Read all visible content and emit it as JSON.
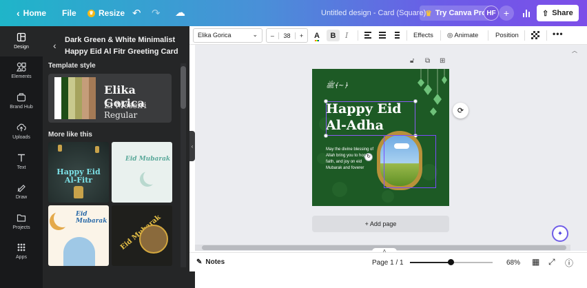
{
  "topbar": {
    "home_label": "Home",
    "file_label": "File",
    "resize_label": "Resize",
    "doc_title": "Untitled design - Card (Square)",
    "try_pro_label": "Try Canva Pro",
    "avatar_initials": "HF",
    "share_label": "Share",
    "icons": [
      "chevron-left-icon",
      "crown-icon",
      "undo-icon",
      "redo-icon",
      "cloud-icon",
      "plus-icon",
      "stats-icon",
      "share-icon"
    ]
  },
  "rail": {
    "items": [
      {
        "label": "Design",
        "icon": "design-icon",
        "active": true
      },
      {
        "label": "Elements",
        "icon": "elements-icon",
        "active": false
      },
      {
        "label": "Brand Hub",
        "icon": "brand-hub-icon",
        "active": false
      },
      {
        "label": "Uploads",
        "icon": "upload-icon",
        "active": false
      },
      {
        "label": "Text",
        "icon": "text-icon",
        "active": false
      },
      {
        "label": "Draw",
        "icon": "draw-icon",
        "active": false
      },
      {
        "label": "Projects",
        "icon": "folder-icon",
        "active": false
      },
      {
        "label": "Apps",
        "icon": "apps-icon",
        "active": false
      }
    ]
  },
  "panel": {
    "title": "Dark Green & White Minimalist Happy Eid Al Fitr Greeting Card",
    "template_style_label": "Template style",
    "style": {
      "swatches": [
        "#ffffff",
        "#1e4d16",
        "#c9c98e",
        "#a6a35e",
        "#c59d7a",
        "#a47a56"
      ],
      "heading_font_sample": "Elika Gorica",
      "body_font_sample": "El Messiri Regular"
    },
    "more_like_this_label": "More like this",
    "thumbnails": [
      {
        "title": "Happy Eid Al-Fitr"
      },
      {
        "title": "Eid Mubarak"
      },
      {
        "title": "Eid Mubarak"
      },
      {
        "title": "Eid Mubarak"
      }
    ]
  },
  "toolbar": {
    "font_name": "Elika Gorica",
    "font_size": "38",
    "minus": "–",
    "plus": "+",
    "text_color_glyph": "A",
    "bold_glyph": "B",
    "italic_glyph": "I",
    "effects_label": "Effects",
    "animate_label": "Animate",
    "position_label": "Position",
    "more_glyph": "•••"
  },
  "canvas": {
    "heading": [
      "Happy Eid",
      "Al-Adha"
    ],
    "body_text": "May the divine blessing of Allah bring you to hope, faith, and joy on eid Mubarak and foverer",
    "add_page_label": "+ Add page",
    "design_color": "#1d5a25",
    "frame_color": "#b8913a"
  },
  "bottombar": {
    "notes_label": "Notes",
    "page_indicator": "Page 1 / 1",
    "zoom_percent": 68,
    "zoom_label": "68%"
  }
}
